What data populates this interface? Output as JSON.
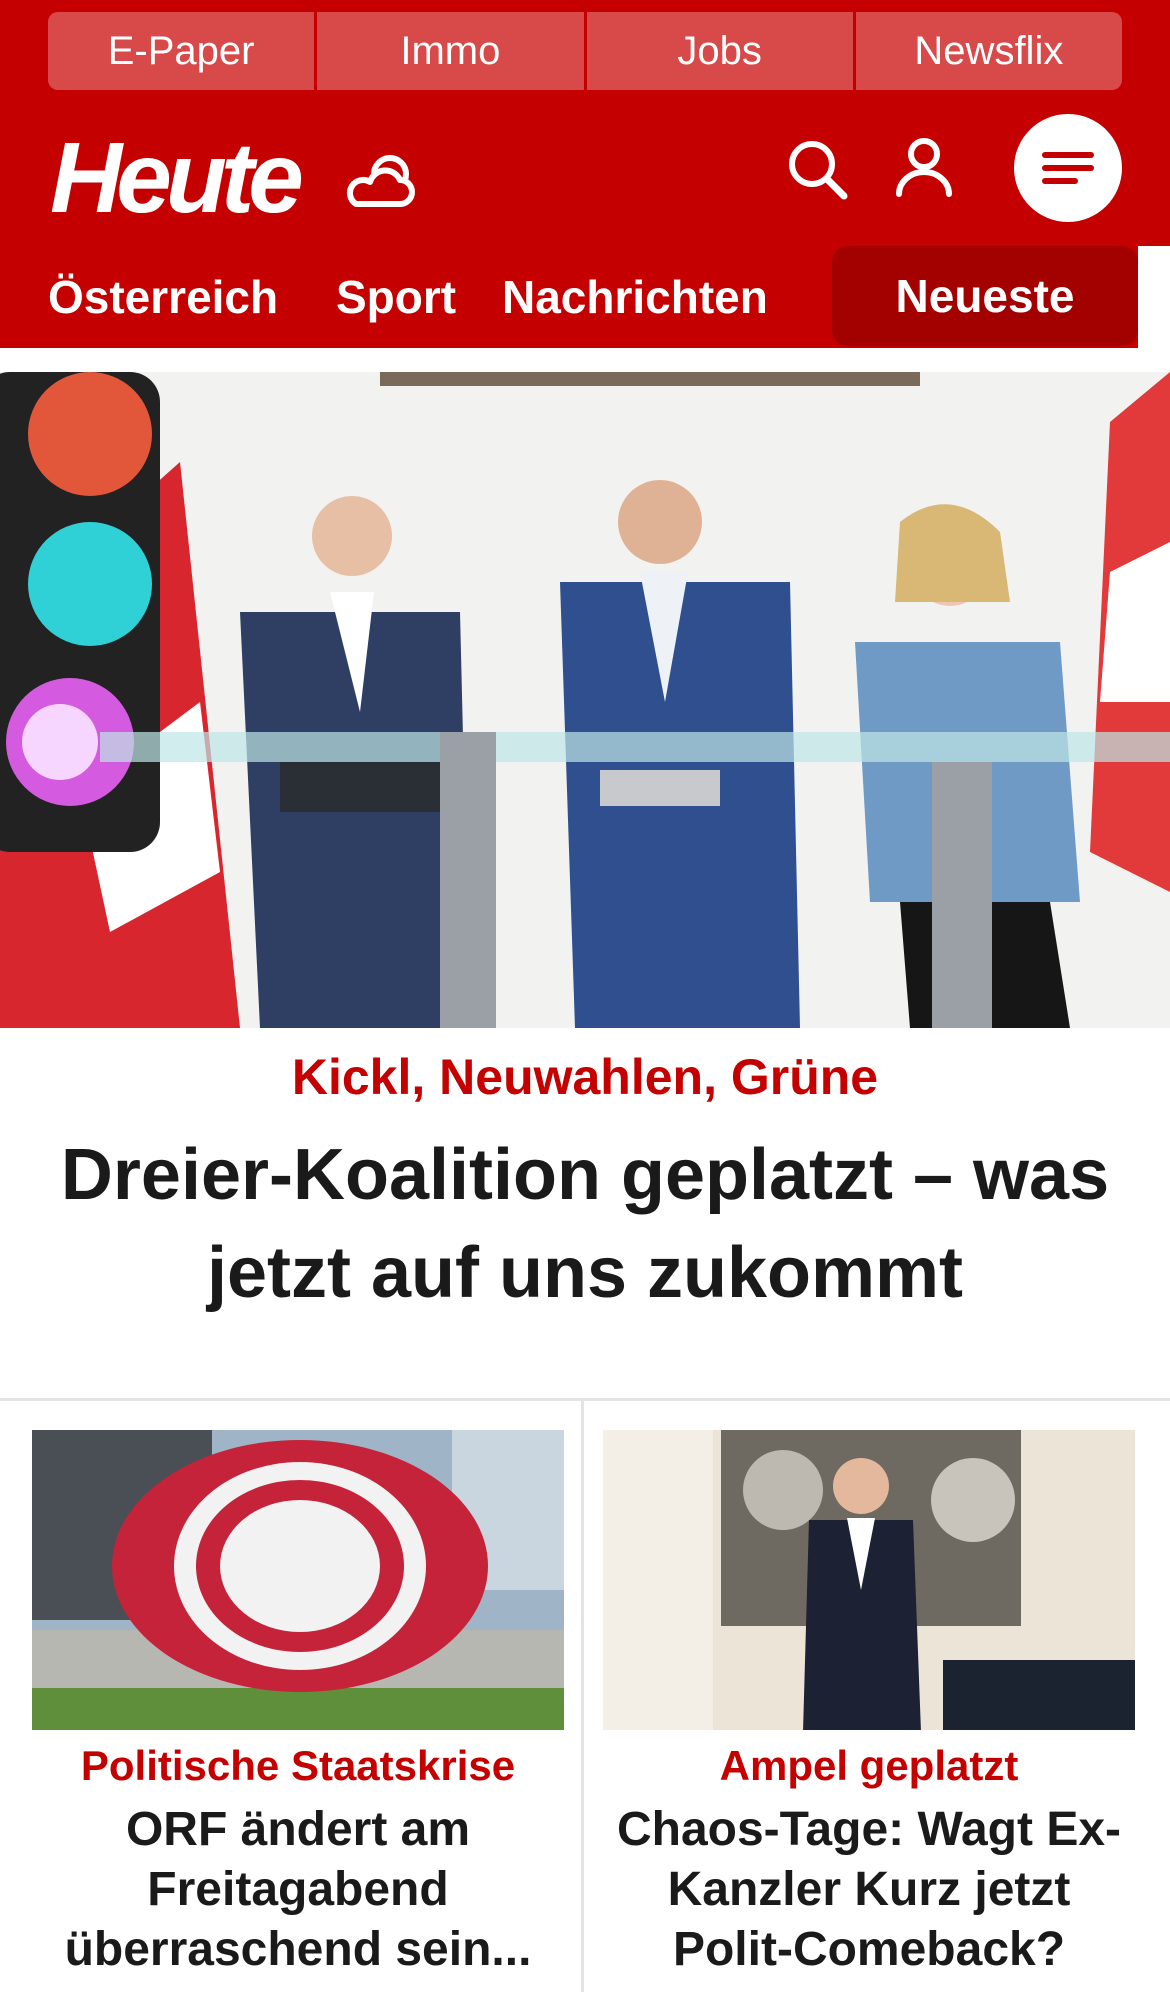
{
  "service_bar": {
    "items": [
      "E-Paper",
      "Immo",
      "Jobs",
      "Newsflix"
    ]
  },
  "header": {
    "logo": "Heute",
    "icons": [
      "weather-icon",
      "search-icon",
      "user-icon",
      "menu-icon"
    ]
  },
  "nav": {
    "items": [
      "Österreich",
      "Sport",
      "Nachrichten"
    ],
    "active": "Neueste"
  },
  "hero": {
    "kicker": "Kickl, Neuwahlen, Grüne",
    "title": "Dreier-Koalition geplatzt – was jetzt auf uns zukommt"
  },
  "cards": [
    {
      "kicker": "Politische Staatskrise",
      "title": "ORF ändert am Freitagabend überraschend sein..."
    },
    {
      "kicker": "Ampel geplatzt",
      "title": "Chaos-Tage: Wagt Ex-Kanzler Kurz jetzt Polit-Comeback?"
    }
  ],
  "colors": {
    "brand_red": "#c40000",
    "active_red": "#a30000",
    "text_dark": "#1a1a1a"
  }
}
